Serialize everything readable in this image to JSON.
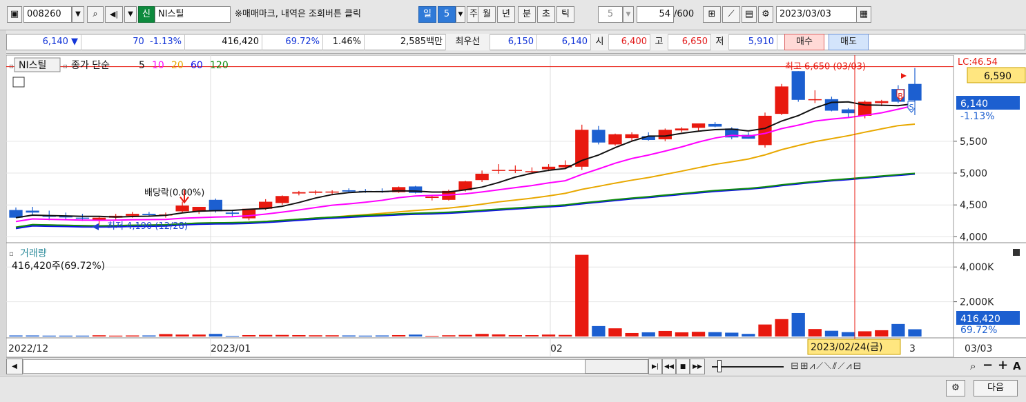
{
  "toolbar": {
    "code": "008260",
    "new_badge": "신",
    "stock_name": "NI스틸",
    "hint": "※매매마크, 내역은 조회버튼 클릭",
    "periods": [
      "일",
      "5",
      "주",
      "월",
      "년",
      "분",
      "초",
      "틱"
    ],
    "tick_value": "5",
    "count": "54",
    "count_total": "/600",
    "date": "2023/03/03"
  },
  "quote": {
    "price": "6,140",
    "change": "70",
    "change_pct": "-1.13%",
    "volume": "416,420",
    "volume_ratio": "69.72%",
    "turnover_pct": "1.46%",
    "amount": "2,585백만",
    "best_label": "최우선",
    "best_ask": "6,150",
    "best_bid": "6,140",
    "open_label": "시",
    "open": "6,400",
    "high_label": "고",
    "high": "6,650",
    "low_label": "저",
    "low": "5,910",
    "buy_button": "매수",
    "sell_button": "매도"
  },
  "price_panel": {
    "title_name": "NI스틸",
    "title_series": "종가 단순",
    "ma_periods": [
      "5",
      "10",
      "20",
      "60",
      "120"
    ],
    "ma_colors": [
      "#111111",
      "#ff00ff",
      "#e8a800",
      "#1010e8",
      "#108c10"
    ],
    "dividend_label": "배당락(0.00%)",
    "high_marker": "최고 6,650 (03/03)",
    "low_marker": "최저 4,190 (12/28)",
    "lc_label": "LC:46.54",
    "current_price_tag": "6,590",
    "last_price_tag": "6,140",
    "last_change_tag": "-1.13%",
    "buy_mark": "B",
    "sell_mark": "S",
    "y_ticks": [
      "5,500",
      "5,000",
      "4,500",
      "4,000"
    ]
  },
  "volume_panel": {
    "title": "거래량",
    "subtitle": "416,420주(69.72%)",
    "y_ticks": [
      "4,000K",
      "2,000K"
    ],
    "last_tag": "416,420",
    "last_pct": "69.72%"
  },
  "x_axis": {
    "labels": [
      "2022/12",
      "2023/01",
      "02",
      "3"
    ],
    "cursor_date": "2023/02/24(금)",
    "end_date": "03/03"
  },
  "footer": {
    "next_button": "다음"
  },
  "colors": {
    "up": "#e8190f",
    "down": "#1c5fd0",
    "accent": "#2f7ad8",
    "tag_yellow": "#ffe680"
  },
  "chart_data": {
    "type": "candlestick",
    "y_unit": "KRW",
    "ylim": [
      3950,
      6700
    ],
    "volume_ylim": [
      0,
      5000000
    ],
    "candles": [
      {
        "o": 4420,
        "h": 4460,
        "l": 4300,
        "c": 4300,
        "v": 60000
      },
      {
        "o": 4410,
        "h": 4470,
        "l": 4340,
        "c": 4380,
        "v": 60000
      },
      {
        "o": 4330,
        "h": 4410,
        "l": 4260,
        "c": 4320,
        "v": 50000
      },
      {
        "o": 4320,
        "h": 4380,
        "l": 4270,
        "c": 4310,
        "v": 50000
      },
      {
        "o": 4300,
        "h": 4360,
        "l": 4250,
        "c": 4290,
        "v": 50000
      },
      {
        "o": 4260,
        "h": 4320,
        "l": 4190,
        "c": 4300,
        "v": 70000
      },
      {
        "o": 4300,
        "h": 4360,
        "l": 4260,
        "c": 4330,
        "v": 50000
      },
      {
        "o": 4330,
        "h": 4390,
        "l": 4300,
        "c": 4360,
        "v": 60000
      },
      {
        "o": 4360,
        "h": 4390,
        "l": 4320,
        "c": 4340,
        "v": 60000
      },
      {
        "o": 4340,
        "h": 4380,
        "l": 4300,
        "c": 4350,
        "v": 140000
      },
      {
        "o": 4400,
        "h": 4550,
        "l": 4380,
        "c": 4490,
        "v": 110000
      },
      {
        "o": 4400,
        "h": 4460,
        "l": 4360,
        "c": 4470,
        "v": 110000
      },
      {
        "o": 4580,
        "h": 4600,
        "l": 4380,
        "c": 4400,
        "v": 150000
      },
      {
        "o": 4380,
        "h": 4420,
        "l": 4320,
        "c": 4360,
        "v": 40000
      },
      {
        "o": 4290,
        "h": 4420,
        "l": 4260,
        "c": 4440,
        "v": 80000
      },
      {
        "o": 4440,
        "h": 4590,
        "l": 4420,
        "c": 4550,
        "v": 90000
      },
      {
        "o": 4530,
        "h": 4650,
        "l": 4500,
        "c": 4640,
        "v": 90000
      },
      {
        "o": 4680,
        "h": 4720,
        "l": 4650,
        "c": 4700,
        "v": 80000
      },
      {
        "o": 4690,
        "h": 4730,
        "l": 4660,
        "c": 4710,
        "v": 70000
      },
      {
        "o": 4700,
        "h": 4730,
        "l": 4660,
        "c": 4710,
        "v": 70000
      },
      {
        "o": 4730,
        "h": 4760,
        "l": 4690,
        "c": 4710,
        "v": 60000
      },
      {
        "o": 4720,
        "h": 4750,
        "l": 4690,
        "c": 4710,
        "v": 50000
      },
      {
        "o": 4720,
        "h": 4760,
        "l": 4690,
        "c": 4700,
        "v": 60000
      },
      {
        "o": 4700,
        "h": 4790,
        "l": 4690,
        "c": 4780,
        "v": 80000
      },
      {
        "o": 4790,
        "h": 4800,
        "l": 4680,
        "c": 4690,
        "v": 110000
      },
      {
        "o": 4610,
        "h": 4660,
        "l": 4570,
        "c": 4630,
        "v": 40000
      },
      {
        "o": 4580,
        "h": 4740,
        "l": 4570,
        "c": 4720,
        "v": 70000
      },
      {
        "o": 4730,
        "h": 4880,
        "l": 4710,
        "c": 4870,
        "v": 90000
      },
      {
        "o": 4890,
        "h": 5040,
        "l": 4860,
        "c": 4990,
        "v": 150000
      },
      {
        "o": 5040,
        "h": 5140,
        "l": 4990,
        "c": 5050,
        "v": 120000
      },
      {
        "o": 5050,
        "h": 5120,
        "l": 5000,
        "c": 5050,
        "v": 80000
      },
      {
        "o": 5020,
        "h": 5090,
        "l": 4990,
        "c": 5030,
        "v": 80000
      },
      {
        "o": 5060,
        "h": 5140,
        "l": 5030,
        "c": 5100,
        "v": 110000
      },
      {
        "o": 5090,
        "h": 5200,
        "l": 5060,
        "c": 5130,
        "v": 90000
      },
      {
        "o": 5100,
        "h": 5760,
        "l": 5050,
        "c": 5680,
        "v": 4700000
      },
      {
        "o": 5680,
        "h": 5740,
        "l": 5450,
        "c": 5480,
        "v": 600000
      },
      {
        "o": 5450,
        "h": 5620,
        "l": 5430,
        "c": 5610,
        "v": 470000
      },
      {
        "o": 5550,
        "h": 5640,
        "l": 5500,
        "c": 5610,
        "v": 200000
      },
      {
        "o": 5580,
        "h": 5640,
        "l": 5510,
        "c": 5520,
        "v": 240000
      },
      {
        "o": 5530,
        "h": 5700,
        "l": 5500,
        "c": 5680,
        "v": 320000
      },
      {
        "o": 5670,
        "h": 5720,
        "l": 5640,
        "c": 5700,
        "v": 240000
      },
      {
        "o": 5710,
        "h": 5760,
        "l": 5660,
        "c": 5780,
        "v": 270000
      },
      {
        "o": 5770,
        "h": 5800,
        "l": 5720,
        "c": 5730,
        "v": 250000
      },
      {
        "o": 5700,
        "h": 5720,
        "l": 5530,
        "c": 5560,
        "v": 220000
      },
      {
        "o": 5600,
        "h": 5640,
        "l": 5540,
        "c": 5540,
        "v": 150000
      },
      {
        "o": 5440,
        "h": 5950,
        "l": 5400,
        "c": 5900,
        "v": 690000
      },
      {
        "o": 5930,
        "h": 6400,
        "l": 5910,
        "c": 6360,
        "v": 1000000
      },
      {
        "o": 6600,
        "h": 6600,
        "l": 6120,
        "c": 6150,
        "v": 1350000
      },
      {
        "o": 6160,
        "h": 6300,
        "l": 6100,
        "c": 6160,
        "v": 430000
      },
      {
        "o": 6160,
        "h": 6200,
        "l": 5970,
        "c": 5980,
        "v": 330000
      },
      {
        "o": 6000,
        "h": 6020,
        "l": 5870,
        "c": 5940,
        "v": 250000
      },
      {
        "o": 5900,
        "h": 6140,
        "l": 5860,
        "c": 6120,
        "v": 300000
      },
      {
        "o": 6100,
        "h": 6150,
        "l": 6050,
        "c": 6130,
        "v": 360000
      },
      {
        "o": 6320,
        "h": 6380,
        "l": 6100,
        "c": 6120,
        "v": 720000
      },
      {
        "o": 6400,
        "h": 6650,
        "l": 5910,
        "c": 6140,
        "v": 416420
      }
    ]
  }
}
